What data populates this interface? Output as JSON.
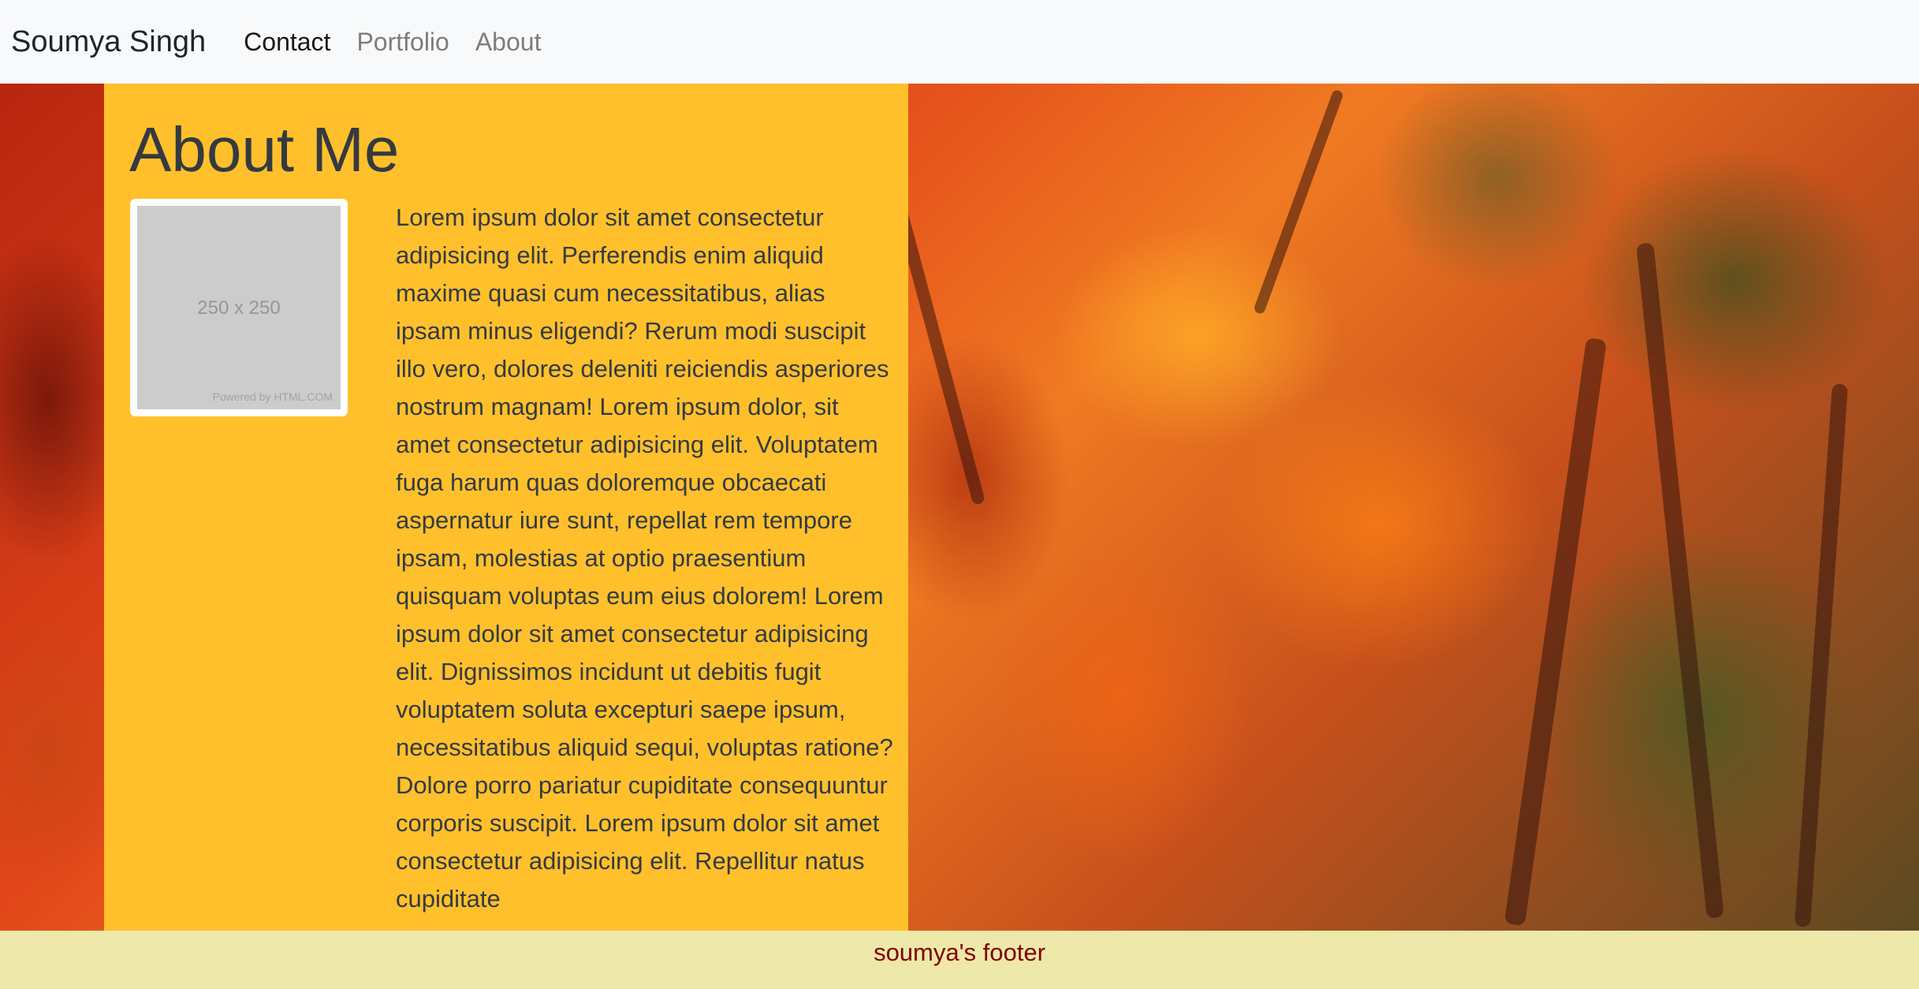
{
  "navbar": {
    "brand": "Soumya Singh",
    "links": [
      {
        "label": "Contact",
        "active": true
      },
      {
        "label": "Portfolio",
        "active": false
      },
      {
        "label": "About",
        "active": false
      }
    ]
  },
  "about": {
    "title": "About Me",
    "image": {
      "size_label": "250 x 250",
      "powered_label": "Powered by HTML.COM"
    },
    "text": "Lorem ipsum dolor sit amet consectetur adipisicing elit. Perferendis enim aliquid maxime quasi cum necessitatibus, alias ipsam minus eligendi? Rerum modi suscipit illo vero, dolores deleniti reiciendis asperiores nostrum magnam! Lorem ipsum dolor, sit amet consectetur adipisicing elit. Voluptatem fuga harum quas doloremque obcaecati aspernatur iure sunt, repellat rem tempore ipsam, molestias at optio praesentium quisquam voluptas eum eius dolorem! Lorem ipsum dolor sit amet consectetur adipisicing elit. Dignissimos incidunt ut debitis fugit voluptatem soluta excepturi saepe ipsum, necessitatibus aliquid sequi, voluptas ratione? Dolore porro pariatur cupiditate consequuntur corporis suscipit. Lorem ipsum dolor sit amet consectetur adipisicing elit. Repellitur natus cupiditate"
  },
  "footer": {
    "text": "soumya's footer"
  },
  "colors": {
    "navbar_bg": "#f8f9fa",
    "panel_bg": "#ffc02c",
    "footer_bg": "#eee8aa",
    "footer_text": "#800000",
    "heading_text": "#343a40"
  }
}
